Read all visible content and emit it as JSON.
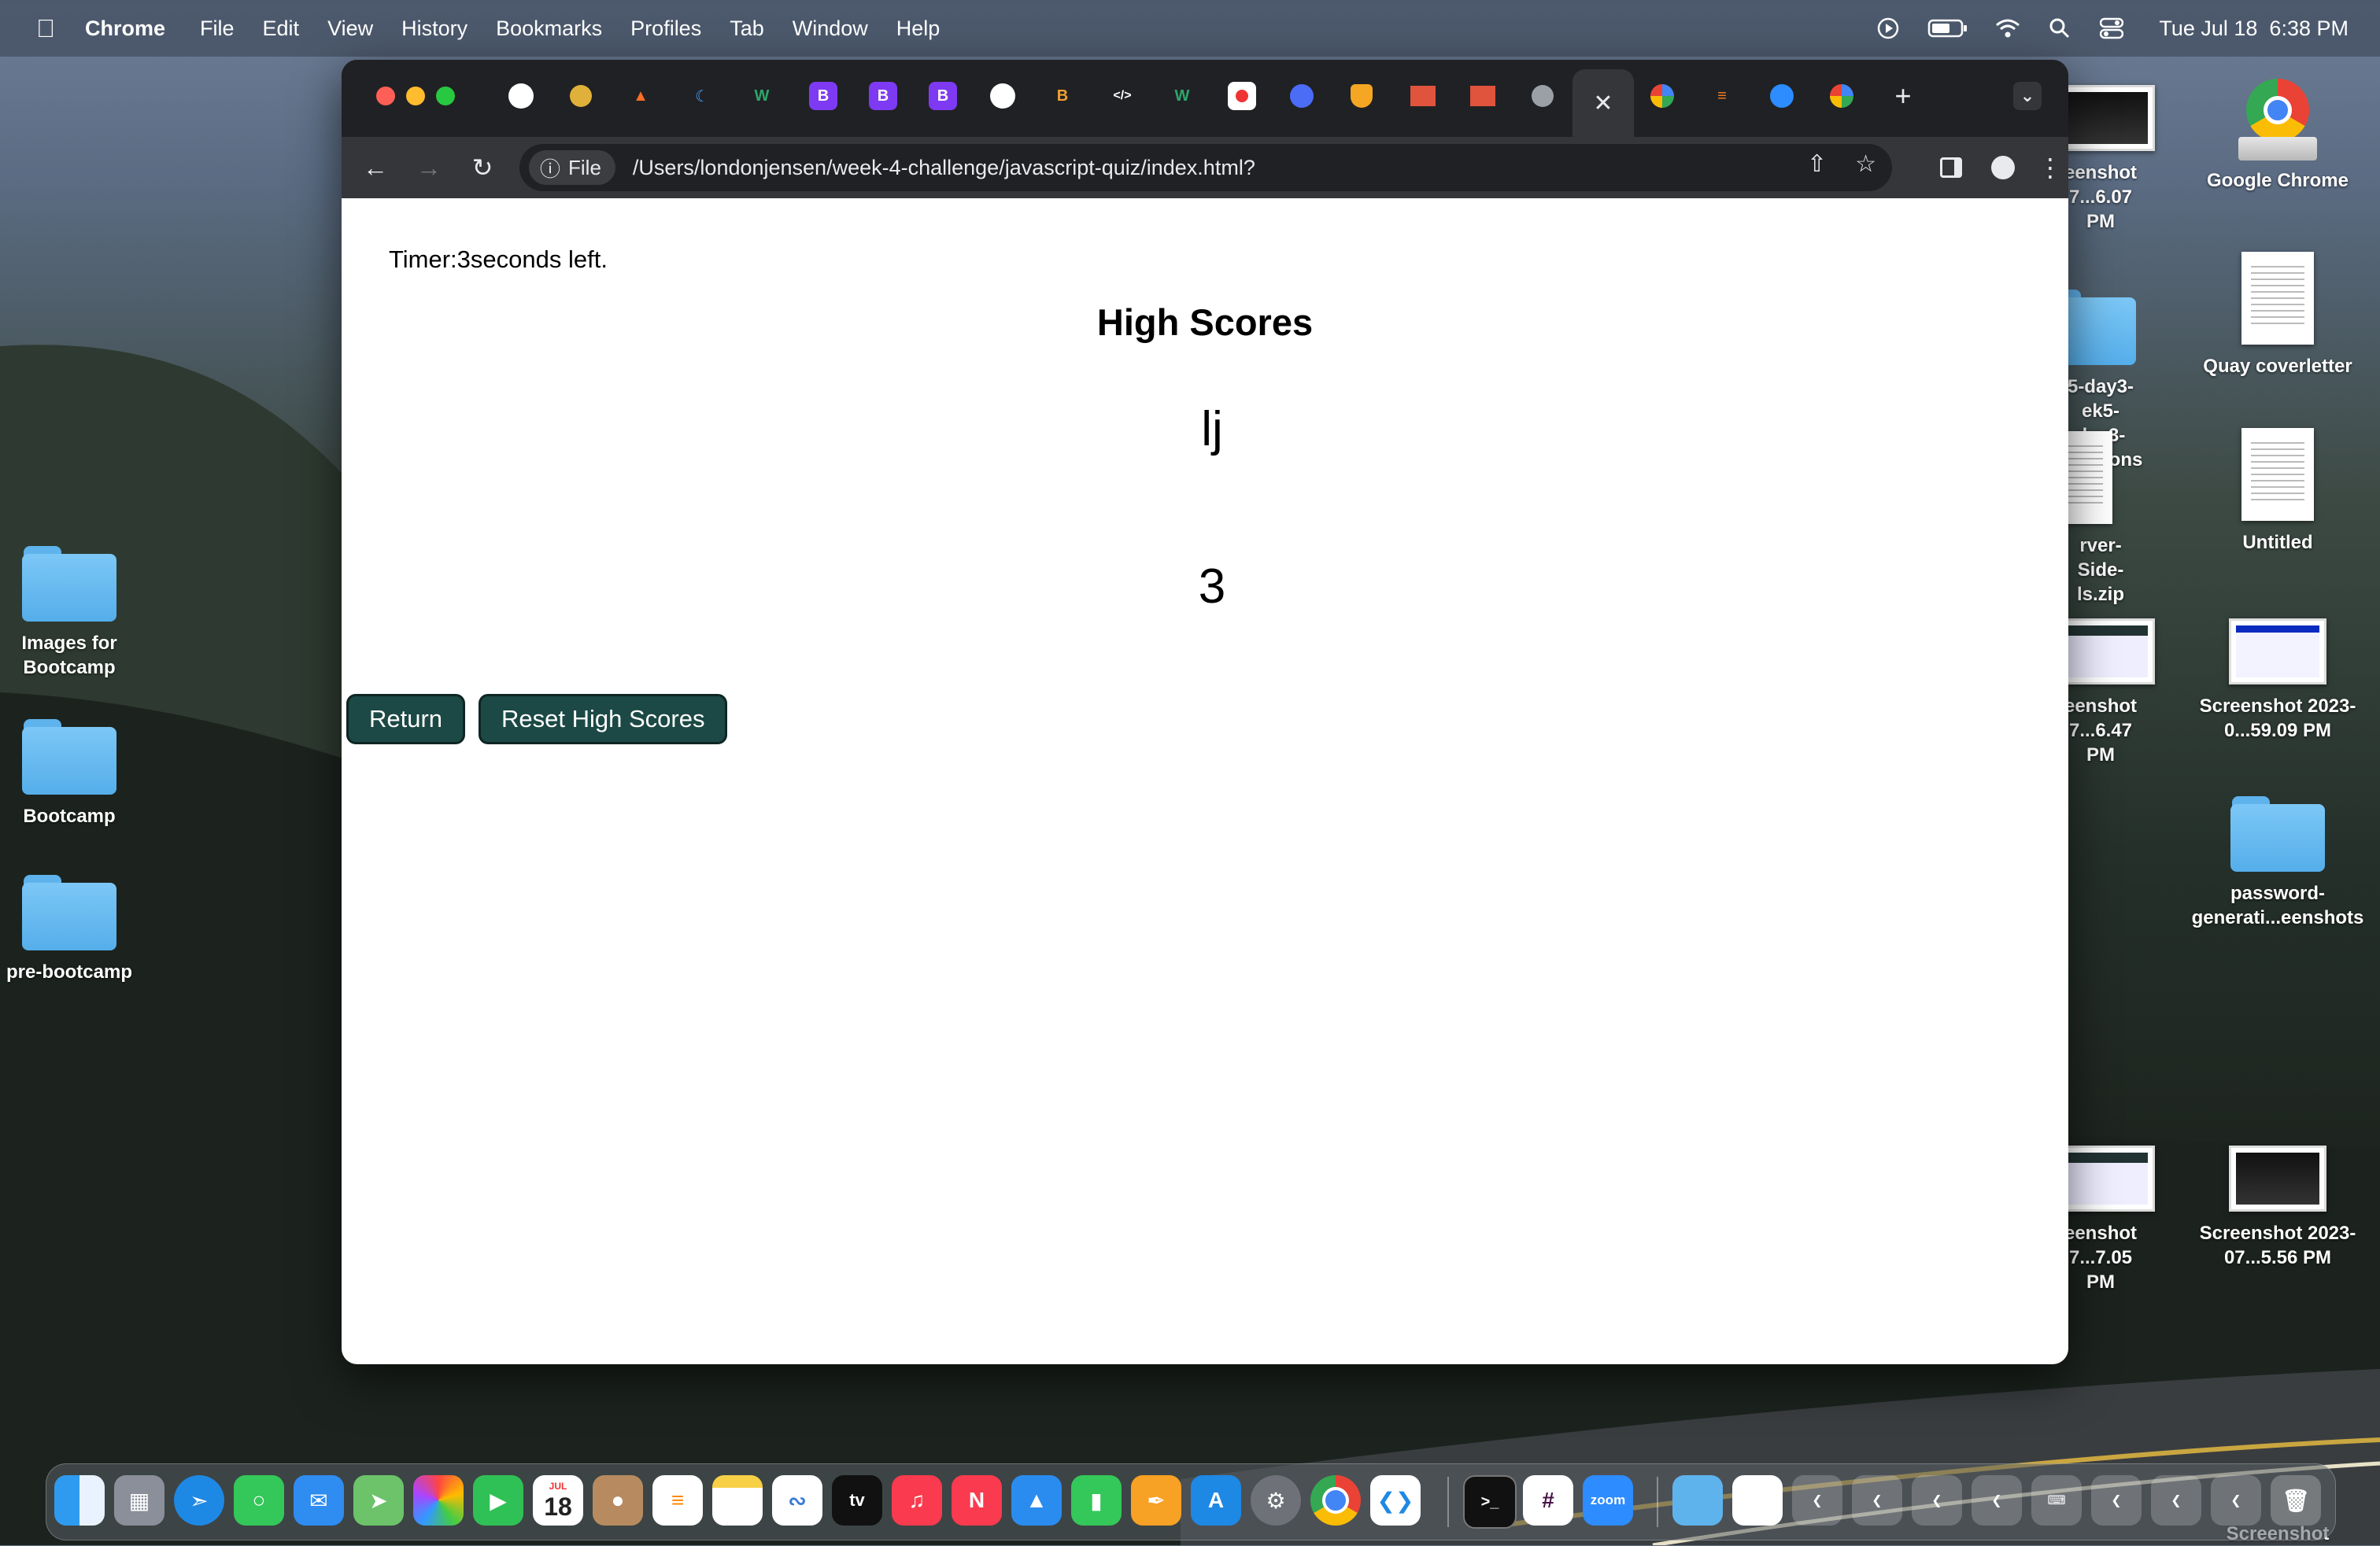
{
  "menubar": {
    "app_name": "Chrome",
    "items": [
      "File",
      "Edit",
      "View",
      "History",
      "Bookmarks",
      "Profiles",
      "Tab",
      "Window",
      "Help"
    ],
    "clock": "Tue Jul 18  6:38 PM",
    "status_icons": [
      "play-icon",
      "battery-icon",
      "wifi-icon",
      "search-icon",
      "control-center-icon"
    ]
  },
  "desktop": {
    "left_icons": [
      {
        "label": "Images for Bootcamp",
        "kind": "folder"
      },
      {
        "label": "Bootcamp",
        "kind": "folder"
      },
      {
        "label": "pre-bootcamp",
        "kind": "folder"
      }
    ],
    "right_icons": [
      {
        "label": "Google Chrome",
        "kind": "app"
      },
      {
        "label": "Quay coverletter",
        "kind": "document"
      },
      {
        "label": "Untitled",
        "kind": "document"
      },
      {
        "label": "Screenshot 2023-0...59.09 PM",
        "kind": "screenshot"
      },
      {
        "label": "password-generati...eenshots",
        "kind": "folder"
      },
      {
        "label": "Screenshot 2023-07...5.56 PM",
        "kind": "screenshot"
      }
    ],
    "partial_icons": [
      {
        "label": "eenshot 7...6.07 PM",
        "kind": "screenshot"
      },
      {
        "label": "5-day3- ek5-day3- solutions",
        "kind": "folder"
      },
      {
        "label": "rver-Side- ls.zip",
        "kind": "zip"
      },
      {
        "label": "eenshot 7...6.47 PM",
        "kind": "screenshot"
      },
      {
        "label": "eenshot 7...7.05 PM",
        "kind": "screenshot"
      }
    ],
    "bottom_right_label": "Screenshot"
  },
  "browser": {
    "tabs": [
      {
        "icon": "github-icon",
        "active": false
      },
      {
        "icon": "coin-icon",
        "active": false
      },
      {
        "icon": "gitlab-icon",
        "active": false
      },
      {
        "icon": "moon-icon",
        "active": false
      },
      {
        "icon": "w-icon",
        "active": false
      },
      {
        "icon": "bootstrap-icon",
        "active": false
      },
      {
        "icon": "bootstrap-icon",
        "active": false
      },
      {
        "icon": "bootstrap-icon",
        "active": false
      },
      {
        "icon": "github-icon",
        "active": false
      },
      {
        "icon": "b-logo-icon",
        "active": false
      },
      {
        "icon": "code-icon",
        "active": false
      },
      {
        "icon": "w-icon",
        "active": false
      },
      {
        "icon": "record-icon",
        "active": false
      },
      {
        "icon": "help-icon",
        "active": false
      },
      {
        "icon": "shield-icon",
        "active": false
      },
      {
        "icon": "day-badge-icon",
        "active": false
      },
      {
        "icon": "day-badge-icon",
        "active": false
      },
      {
        "icon": "globe-icon",
        "active": false
      },
      {
        "icon": "close-icon",
        "active": true
      },
      {
        "icon": "google-icon",
        "active": false
      },
      {
        "icon": "stackoverflow-icon",
        "active": false
      },
      {
        "icon": "zoom-icon",
        "active": false
      },
      {
        "icon": "google-icon",
        "active": false
      }
    ],
    "new_tab_label": "+",
    "url_scheme_label": "File",
    "url": "/Users/londonjensen/week-4-challenge/javascript-quiz/index.html?"
  },
  "page": {
    "timer_text": "Timer:3seconds left.",
    "title": "High Scores",
    "scores": [
      {
        "initials": "lj",
        "score": "3"
      }
    ],
    "buttons": {
      "return": "Return",
      "reset": "Reset High Scores"
    },
    "button_color": "#1c4945"
  },
  "dock": {
    "apps": [
      "Finder",
      "Launchpad",
      "Safari",
      "Messages",
      "Mail",
      "Maps",
      "Photos",
      "FaceTime",
      "Calendar",
      "Contacts",
      "Reminders",
      "Notes",
      "Freeform",
      "TV",
      "Music",
      "News",
      "Keynote",
      "Numbers",
      "Pages",
      "App Store",
      "System Settings",
      "Chrome",
      "VS Code",
      "Terminal",
      "Slack",
      "Zoom"
    ],
    "calendar_month": "JUL",
    "calendar_day": "18",
    "tv_label": "tv",
    "zoom_label": "zoom"
  }
}
